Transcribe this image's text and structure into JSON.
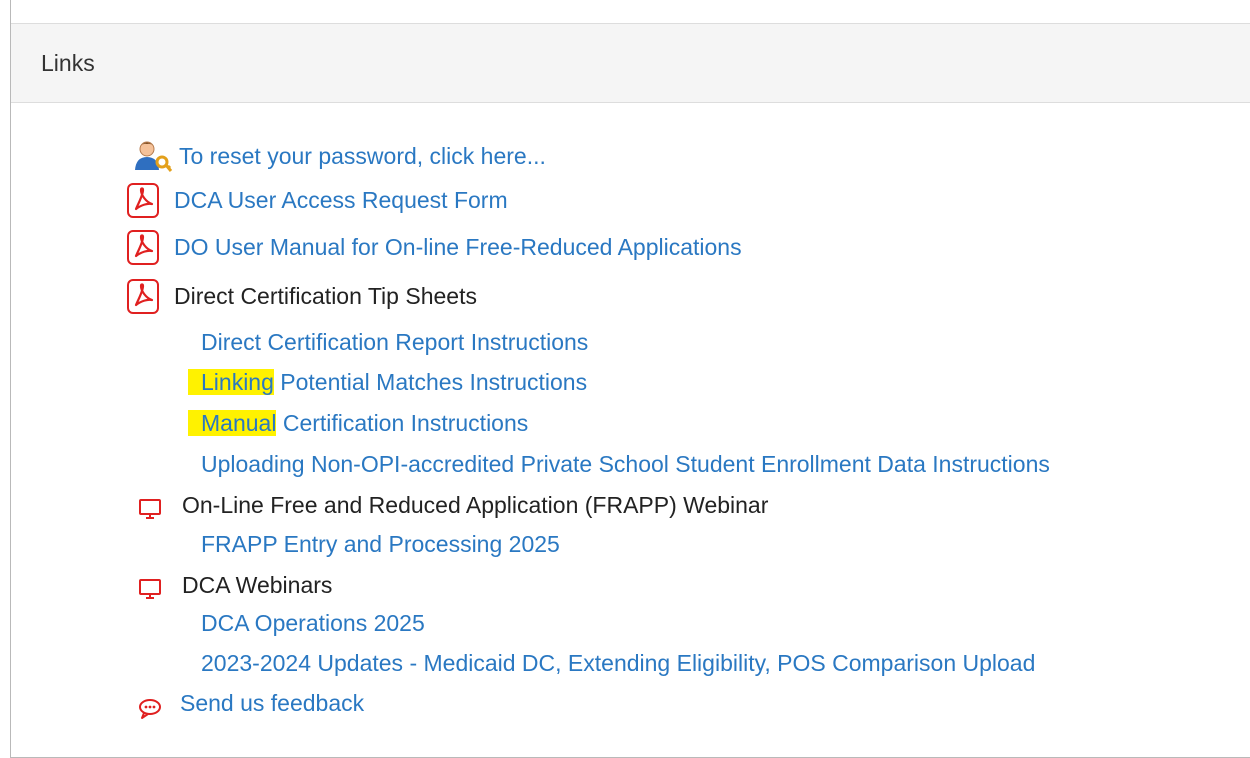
{
  "panel": {
    "title": "Links"
  },
  "items": {
    "reset_password": {
      "label": "To reset your password, click here...",
      "icon": "user-key-icon"
    },
    "dca_access_form": {
      "label": "DCA User Access Request Form",
      "icon": "pdf-icon"
    },
    "do_user_manual": {
      "label": "DO User Manual for On-line Free-Reduced Applications",
      "icon": "pdf-icon"
    },
    "direct_cert_tips": {
      "label": "Direct Certification Tip Sheets",
      "icon": "pdf-icon"
    },
    "direct_cert_report": {
      "label": "Direct Certification Report Instructions"
    },
    "linking_matches": {
      "highlight": "Linking",
      "rest": " Potential Matches Instructions"
    },
    "manual_cert": {
      "highlight": "Manual",
      "rest": " Certification Instructions"
    },
    "uploading_non_opi": {
      "label": "Uploading Non-OPI-accredited Private School Student Enrollment Data Instructions"
    },
    "frapp_webinar": {
      "label": "On-Line Free and Reduced Application (FRAPP) Webinar",
      "icon": "monitor-icon"
    },
    "frapp_entry": {
      "label": "FRAPP Entry and Processing 2025"
    },
    "dca_webinars": {
      "label": "DCA Webinars",
      "icon": "monitor-icon"
    },
    "dca_operations": {
      "label": "DCA Operations 2025"
    },
    "updates_2023": {
      "label": "2023-2024 Updates - Medicaid DC, Extending Eligibility, POS Comparison Upload"
    },
    "feedback": {
      "label": "Send us feedback",
      "icon": "chat-icon"
    }
  },
  "colors": {
    "link": "#2a78c2",
    "icon_red": "#e02020",
    "highlight": "#fff200",
    "heading_bg": "#f5f5f5"
  }
}
